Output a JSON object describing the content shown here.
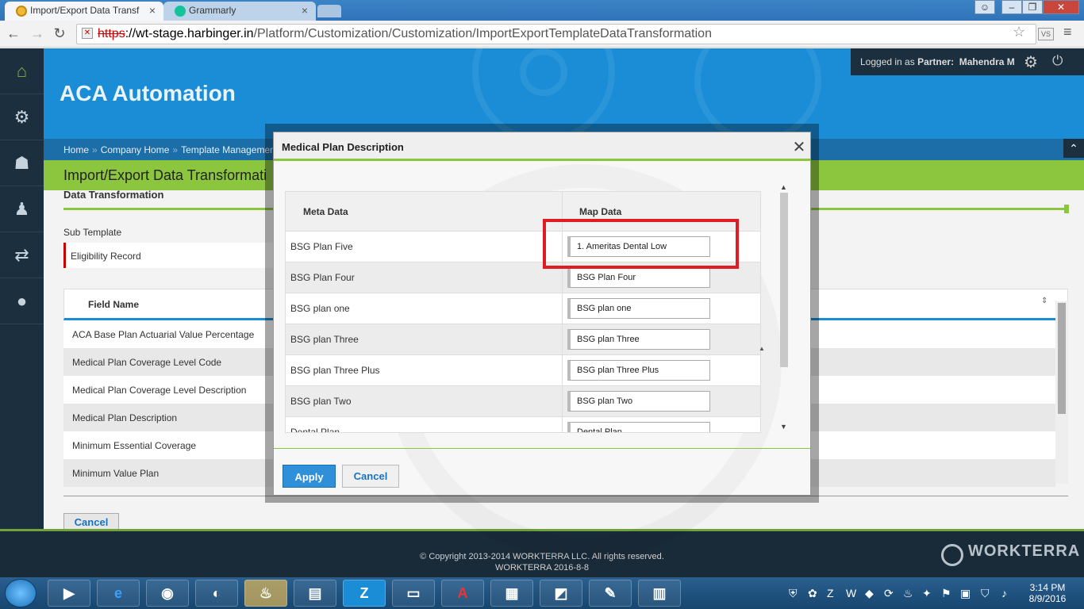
{
  "browser": {
    "tabs": [
      {
        "title": "Import/Export Data Transf"
      },
      {
        "title": "Grammarly"
      }
    ],
    "url_scheme": "https",
    "url_host": "://wt-stage.harbinger.in",
    "url_path": "/Platform/Customization/Customization/ImportExportTemplateDataTransformation",
    "window_controls": {
      "minimize": "–",
      "maximize": "❐",
      "close": "✕"
    }
  },
  "header": {
    "app_title": "ACA Automation",
    "logged_in_prefix": "Logged in as ",
    "partner_label": "Partner:",
    "user_name": "Mahendra M"
  },
  "breadcrumb": [
    "Home",
    "Company Home",
    "Template Management"
  ],
  "breadcrumb_sep": "»",
  "page": {
    "title": "Import/Export Data Transformati",
    "section_title": "Data Transformation",
    "sub_template_label": "Sub Template",
    "sub_template_value": "Eligibility Record",
    "grid_header": "Field Name",
    "fields": [
      "ACA Base Plan Actuarial Value Percentage",
      "Medical Plan Coverage Level Code",
      "Medical Plan Coverage Level Description",
      "Medical Plan Description",
      "Minimum Essential Coverage",
      "Minimum Value Plan"
    ],
    "cancel_label": "Cancel"
  },
  "modal": {
    "title": "Medical Plan Description",
    "close_glyph": "✕",
    "col_meta": "Meta Data",
    "col_map": "Map Data",
    "rows": [
      {
        "meta": "BSG Plan Five",
        "map": "1. Ameritas Dental Low"
      },
      {
        "meta": "BSG Plan Four",
        "map": "BSG Plan Four"
      },
      {
        "meta": "BSG plan one",
        "map": "BSG plan one"
      },
      {
        "meta": "BSG plan Three",
        "map": "BSG plan Three"
      },
      {
        "meta": "BSG plan Three Plus",
        "map": "BSG plan Three Plus"
      },
      {
        "meta": "BSG plan Two",
        "map": "BSG plan Two"
      },
      {
        "meta": "Dental Plan",
        "map": "Dental Plan"
      }
    ],
    "apply_label": "Apply",
    "cancel_label": "Cancel"
  },
  "footer": {
    "copyright": "© Copyright 2013-2014 WORKTERRA LLC. All rights reserved.",
    "version": "WORKTERRA 2016-8-8",
    "brand": "WORKTERRA"
  },
  "taskbar": {
    "apps": [
      "▶",
      "e",
      "◉",
      "◐",
      "♨",
      "▤",
      "Z",
      "▭",
      "A",
      "▦",
      "◩",
      "✎",
      "▥"
    ],
    "time": "3:14 PM",
    "date": "8/9/2016"
  },
  "colors": {
    "accent_green": "#8cc63f",
    "banner_blue": "#1a8dd6",
    "nav_dark": "#1b2f3f",
    "highlight_red": "#e01b24"
  }
}
